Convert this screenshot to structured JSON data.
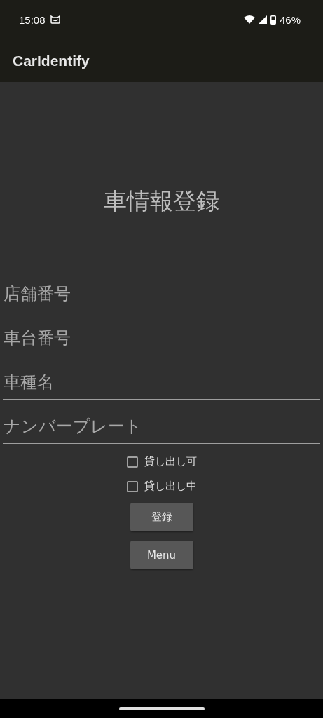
{
  "status_bar": {
    "time": "15:08",
    "battery": "46%"
  },
  "app_bar": {
    "title": "CarIdentify"
  },
  "heading": "車情報登録",
  "fields": [
    {
      "placeholder": "店舗番号"
    },
    {
      "placeholder": "車台番号"
    },
    {
      "placeholder": "車種名"
    },
    {
      "placeholder": "ナンバープレート"
    }
  ],
  "checkboxes": [
    {
      "label": "貸し出し可",
      "checked": false
    },
    {
      "label": "貸し出し中",
      "checked": false
    }
  ],
  "buttons": [
    "登録",
    "Menu"
  ]
}
